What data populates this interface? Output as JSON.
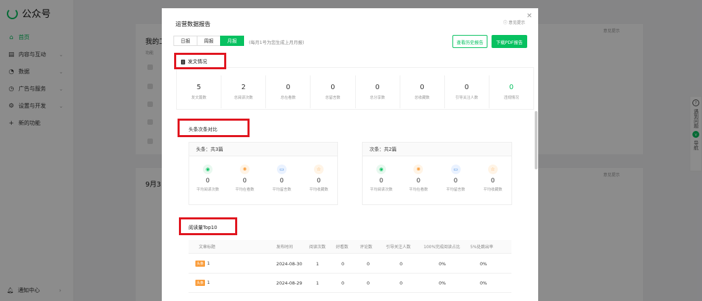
{
  "app": {
    "name": "公众号"
  },
  "sidebar": {
    "items": [
      {
        "label": "首页",
        "icon": "home-icon",
        "active": true
      },
      {
        "label": "内容与互动",
        "icon": "document-icon"
      },
      {
        "label": "数据",
        "icon": "chart-icon"
      },
      {
        "label": "广告与服务",
        "icon": "ad-icon"
      },
      {
        "label": "设置与开发",
        "icon": "gear-icon"
      },
      {
        "label": "新的功能",
        "icon": "plus-icon"
      }
    ],
    "notification": "通知中心"
  },
  "background": {
    "heading": "我的工",
    "sub": "功能",
    "date_heading": "9月3",
    "feedback1": "意见提示",
    "feedback2": "意见提示",
    "rail": {
      "items": [
        "遇到问题",
        "导航"
      ]
    }
  },
  "modal": {
    "title": "运营数据报告",
    "feedback": "意见提示",
    "tabs": [
      "日报",
      "周报",
      "月报"
    ],
    "active_tab": "月报",
    "tab_note": "(每月1号为您生成上月月报)",
    "btn_history": "查看历史报告",
    "btn_pdf": "下载PDF报告",
    "section1": {
      "title": "发文情况",
      "stats": [
        {
          "value": "5",
          "label": "发文篇数"
        },
        {
          "value": "2",
          "label": "总阅读次数"
        },
        {
          "value": "0",
          "label": "总在看数"
        },
        {
          "value": "0",
          "label": "总留言数"
        },
        {
          "value": "0",
          "label": "总分享数"
        },
        {
          "value": "0",
          "label": "总收藏数"
        },
        {
          "value": "0",
          "label": "引导关注人数"
        },
        {
          "value": "0",
          "label": "违规情况"
        }
      ]
    },
    "section2": {
      "title": "头条次条对比",
      "cards": [
        {
          "title": "头条：共3篇",
          "items": [
            {
              "value": "0",
              "label": "平均阅读次数"
            },
            {
              "value": "0",
              "label": "平均在看数"
            },
            {
              "value": "0",
              "label": "平均留言数"
            },
            {
              "value": "0",
              "label": "平均收藏数"
            }
          ]
        },
        {
          "title": "次条：共2篇",
          "items": [
            {
              "value": "0",
              "label": "平均阅读次数"
            },
            {
              "value": "0",
              "label": "平均在看数"
            },
            {
              "value": "0",
              "label": "平均留言数"
            },
            {
              "value": "0",
              "label": "平均收藏数"
            }
          ]
        }
      ]
    },
    "section3": {
      "title": "阅读量Top10",
      "columns": [
        "文章标题",
        "发布时间",
        "阅读次数",
        "好看数",
        "评论数",
        "引导关注人数",
        "100%完成阅读占比",
        "5%处跳出率"
      ],
      "rows": [
        {
          "badge": "头条",
          "title": "1",
          "date": "2024-08-30",
          "reads": "1",
          "likes": "0",
          "comments": "0",
          "follows": "0",
          "complete": "0%",
          "bounce": "0%"
        },
        {
          "badge": "头条",
          "title": "1",
          "date": "2024-08-29",
          "reads": "1",
          "likes": "0",
          "comments": "0",
          "follows": "0",
          "complete": "0%",
          "bounce": "0%"
        }
      ]
    }
  },
  "colors": {
    "accent": "#07c160",
    "highlight": "#e0141e",
    "badge": "#fa9d3b"
  }
}
